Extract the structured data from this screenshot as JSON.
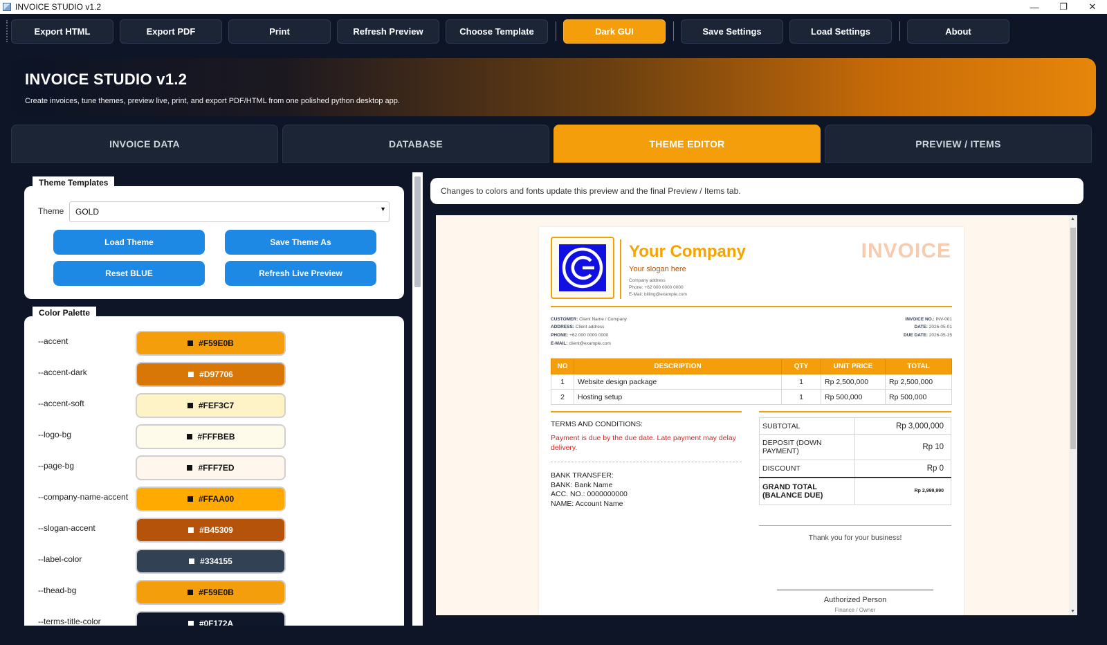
{
  "window": {
    "title": "INVOICE STUDIO v1.2"
  },
  "toolbar": {
    "export_html": "Export HTML",
    "export_pdf": "Export PDF",
    "print": "Print",
    "refresh_preview": "Refresh Preview",
    "choose_template": "Choose Template",
    "dark_gui": "Dark GUI",
    "save_settings": "Save Settings",
    "load_settings": "Load Settings",
    "about": "About"
  },
  "banner": {
    "title": "INVOICE STUDIO v1.2",
    "subtitle": "Create invoices, tune themes, preview live, print, and export PDF/HTML from one polished python desktop app."
  },
  "tabs": [
    "INVOICE DATA",
    "DATABASE",
    "THEME EDITOR",
    "PREVIEW / ITEMS"
  ],
  "active_tab": "THEME EDITOR",
  "theme_templates": {
    "title": "Theme Templates",
    "theme_label": "Theme",
    "theme_value": "GOLD",
    "load_theme": "Load Theme",
    "save_theme_as": "Save Theme As",
    "reset_blue": "Reset BLUE",
    "refresh_live_preview": "Refresh Live Preview"
  },
  "color_palette": {
    "title": "Color Palette",
    "items": [
      {
        "name": "--accent",
        "value": "#F59E0B",
        "color": "#F59E0B",
        "text_color": "#111111"
      },
      {
        "name": "--accent-dark",
        "value": "#D97706",
        "color": "#D97706",
        "text_color": "#ffffff"
      },
      {
        "name": "--accent-soft",
        "value": "#FEF3C7",
        "color": "#FEF3C7",
        "text_color": "#111111"
      },
      {
        "name": "--logo-bg",
        "value": "#FFFBEB",
        "color": "#FFFBEB",
        "text_color": "#111111"
      },
      {
        "name": "--page-bg",
        "value": "#FFF7ED",
        "color": "#FFF7ED",
        "text_color": "#111111"
      },
      {
        "name": "--company-name-accent",
        "value": "#FFAA00",
        "color": "#FFAA00",
        "text_color": "#111111"
      },
      {
        "name": "--slogan-accent",
        "value": "#B45309",
        "color": "#B45309",
        "text_color": "#ffffff"
      },
      {
        "name": "--label-color",
        "value": "#334155",
        "color": "#334155",
        "text_color": "#ffffff"
      },
      {
        "name": "--thead-bg",
        "value": "#F59E0B",
        "color": "#F59E0B",
        "text_color": "#111111"
      },
      {
        "name": "--terms-title-color",
        "value": "#0F172A",
        "color": "#0F172A",
        "text_color": "#ffffff"
      }
    ]
  },
  "preview_notice": "Changes to colors and fonts update this preview and the final Preview / Items tab.",
  "invoice": {
    "company": "Your Company",
    "slogan": "Your slogan here",
    "company_address": "Company address",
    "company_phone": "Phone: +62 000 0000 0000",
    "company_email": "E-Mail: billing@example.com",
    "title": "INVOICE",
    "customer_label": "CUSTOMER:",
    "customer": "Client Name / Company",
    "address_label": "ADDRESS:",
    "address": "Client address",
    "phone_label": "PHONE:",
    "phone": "+62 000 0000 0000",
    "email_label": "E-MAIL:",
    "email": "client@example.com",
    "invoice_no_label": "INVOICE NO.:",
    "invoice_no": "INV-001",
    "date_label": "DATE:",
    "date": "2026-05-01",
    "due_label": "DUE DATE:",
    "due": "2026-05-15",
    "columns": [
      "NO",
      "DESCRIPTION",
      "QTY",
      "UNIT PRICE",
      "TOTAL"
    ],
    "rows": [
      {
        "no": "1",
        "desc": "Website design package",
        "qty": "1",
        "unit": "Rp 2,500,000",
        "total": "Rp 2,500,000"
      },
      {
        "no": "2",
        "desc": "Hosting setup",
        "qty": "1",
        "unit": "Rp 500,000",
        "total": "Rp 500,000"
      }
    ],
    "terms_title": "TERMS AND CONDITIONS:",
    "terms_text": "Payment is due by the due date. Late payment may delay delivery.",
    "bank_title": "BANK TRANSFER:",
    "bank_name": "BANK: Bank Name",
    "bank_acc": "ACC. NO.: 0000000000",
    "bank_holder": "NAME: Account Name",
    "subtotal_label": "SUBTOTAL",
    "subtotal": "Rp 3,000,000",
    "deposit_label": "DEPOSIT (DOWN PAYMENT)",
    "deposit": "Rp 10",
    "discount_label": "DISCOUNT",
    "discount": "Rp 0",
    "grand_label": "GRAND TOTAL (BALANCE DUE)",
    "grand": "Rp 2,999,990",
    "thanks": "Thank you for your business!",
    "signer": "Authorized Person",
    "signer_role": "Finance / Owner"
  }
}
